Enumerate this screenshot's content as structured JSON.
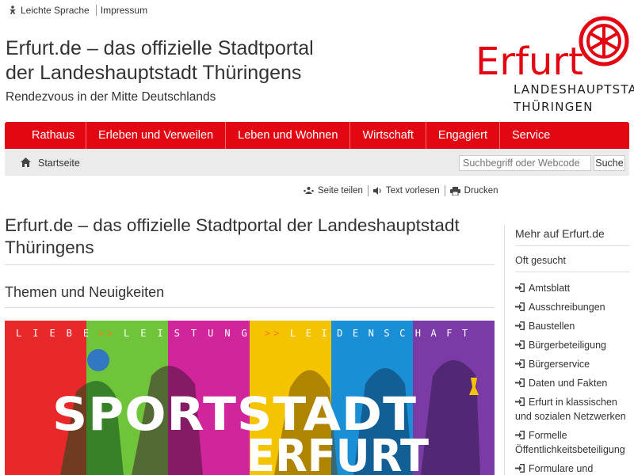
{
  "top_links": [
    "Leichte Sprache",
    "Impressum"
  ],
  "site": {
    "title_line1": "Erfurt.de – das offizielle Stadtportal",
    "title_line2": "der Landeshauptstadt Thüringens",
    "subtitle": "Rendezvous in der Mitte Deutschlands"
  },
  "logo": {
    "word": "Erfurt",
    "line1": "LANDESHAUPTSTADT",
    "line2": "THÜRINGEN",
    "color": "#e30613"
  },
  "nav": [
    "Rathaus",
    "Erleben und Verweilen",
    "Leben und Wohnen",
    "Wirtschaft",
    "Engagiert",
    "Service"
  ],
  "breadcrumb": "Startseite",
  "search": {
    "placeholder": "Suchbegriff oder Webcode",
    "button": "Suche"
  },
  "tools": [
    "Seite teilen",
    "Text vorlesen",
    "Drucken"
  ],
  "main": {
    "heading": "Erfurt.de – das offizielle Stadtportal der Landeshauptstadt Thüringens",
    "subheading": "Themen und Neuigkeiten"
  },
  "banner": {
    "tagline": [
      "LIEBE",
      ">>",
      "LEISTUNG",
      ">>",
      "LEIDENSCHAFT"
    ],
    "line1": "SPORTSTADT",
    "line2": "ERFURT",
    "stripe_colors": [
      "#e8282b",
      "#6fc43a",
      "#d1269b",
      "#f5c400",
      "#1b8fd6",
      "#7b3aa6"
    ]
  },
  "sidebar": {
    "title": "Mehr auf Erfurt.de",
    "subtitle": "Oft gesucht",
    "items": [
      "Amtsblatt",
      "Ausschreibungen",
      "Baustellen",
      "Bürgerbeteiligung",
      "Bürgerservice",
      "Daten und Fakten",
      "Erfurt in klassischen und sozialen Netzwerken",
      "Formelle Öffentlichkeitsbeteiligung",
      "Formulare und"
    ]
  }
}
